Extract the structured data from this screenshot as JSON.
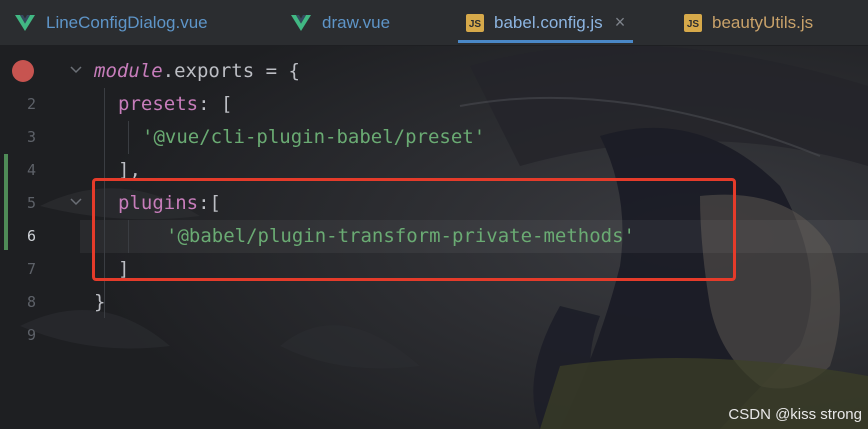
{
  "tabs": [
    {
      "label": "LineConfigDialog.vue",
      "type": "vue",
      "icon": "vue-icon"
    },
    {
      "label": "draw.vue",
      "type": "vue",
      "icon": "vue-icon"
    },
    {
      "label": "babel.config.js",
      "type": "js",
      "icon": "js-icon",
      "active": true,
      "close": "×"
    },
    {
      "label": "beautyUtils.js",
      "type": "js",
      "icon": "js-icon"
    }
  ],
  "js_badge": "JS",
  "gutter": {
    "line_numbers": [
      "2",
      "3",
      "4",
      "5",
      "6",
      "7",
      "8",
      "9"
    ],
    "current_line": "6"
  },
  "code": {
    "line1": {
      "kw": "module",
      "rest": ".exports = {"
    },
    "line2": {
      "prop": "presets",
      "rest": ": ["
    },
    "line3": {
      "str": "'@vue/cli-plugin-babel/preset'"
    },
    "line4": {
      "text": "],"
    },
    "line5": {
      "prop": "plugins",
      "rest": ":["
    },
    "line6": {
      "str": "'@babel/plugin-transform-private-methods'"
    },
    "line7": {
      "text": "]"
    },
    "line8": {
      "text": "}"
    }
  },
  "watermark": "CSDN @kiss strong",
  "colors": {
    "keyword": "#c77dbb",
    "string": "#6aab73",
    "highlight_border": "#e53b2a",
    "breakpoint": "#c75450"
  }
}
